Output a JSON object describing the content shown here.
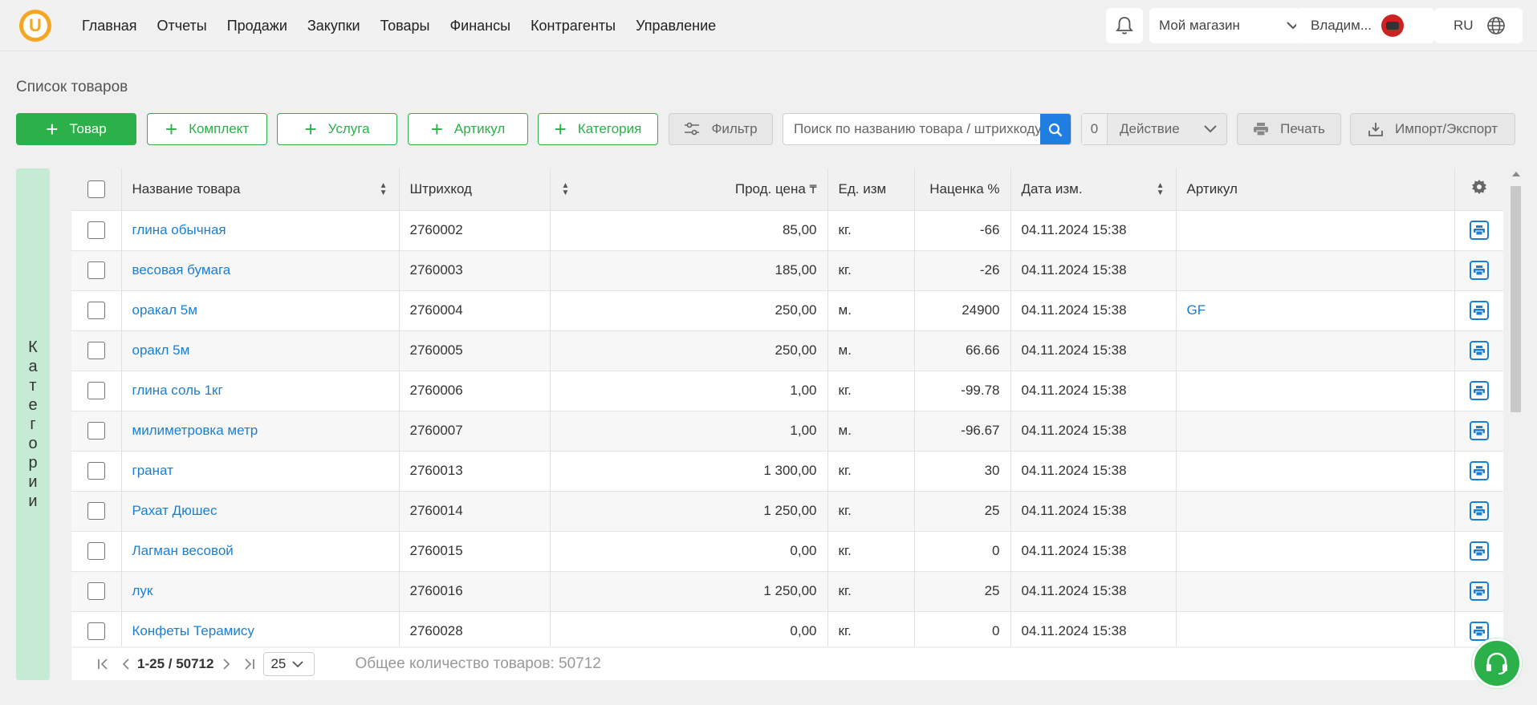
{
  "colors": {
    "brand": "#f5a623",
    "primary": "#2bb04a",
    "link": "#1a7fd4",
    "category_bar": "#c6ebd4"
  },
  "nav": [
    "Главная",
    "Отчеты",
    "Продажи",
    "Закупки",
    "Товары",
    "Финансы",
    "Контрагенты",
    "Управление"
  ],
  "header": {
    "shop": "Мой магазин",
    "user": "Владим...",
    "lang": "RU"
  },
  "page_title": "Список товаров",
  "toolbar": {
    "add_product": "Товар",
    "add_kit": "Комплект",
    "add_service": "Услуга",
    "add_article": "Артикул",
    "add_category": "Категория",
    "filter": "Фильтр",
    "search_placeholder": "Поиск по названию товара / штрихкоду",
    "selected_count": "0",
    "action": "Действие",
    "print": "Печать",
    "import_export": "Импорт/Экспорт"
  },
  "category_label": [
    "К",
    "а",
    "т",
    "е",
    "г",
    "о",
    "р",
    "и",
    "и"
  ],
  "table": {
    "columns": [
      "Название товара",
      "Штрихкод",
      "Прод. цена",
      "Ед. изм",
      "Наценка %",
      "Дата изм.",
      "Артикул"
    ],
    "rows": [
      {
        "name": "глина обычная",
        "barcode": "2760002",
        "price": "85,00",
        "unit": "кг.",
        "markup": "-66",
        "date": "04.11.2024 15:38",
        "article": ""
      },
      {
        "name": "весовая бумага",
        "barcode": "2760003",
        "price": "185,00",
        "unit": "кг.",
        "markup": "-26",
        "date": "04.11.2024 15:38",
        "article": ""
      },
      {
        "name": "оракал 5м",
        "barcode": "2760004",
        "price": "250,00",
        "unit": "м.",
        "markup": "24900",
        "date": "04.11.2024 15:38",
        "article": "GF"
      },
      {
        "name": "оракл 5м",
        "barcode": "2760005",
        "price": "250,00",
        "unit": "м.",
        "markup": "66.66",
        "date": "04.11.2024 15:38",
        "article": ""
      },
      {
        "name": "глина соль 1кг",
        "barcode": "2760006",
        "price": "1,00",
        "unit": "кг.",
        "markup": "-99.78",
        "date": "04.11.2024 15:38",
        "article": ""
      },
      {
        "name": "милиметровка метр",
        "barcode": "2760007",
        "price": "1,00",
        "unit": "м.",
        "markup": "-96.67",
        "date": "04.11.2024 15:38",
        "article": ""
      },
      {
        "name": "гранат",
        "barcode": "2760013",
        "price": "1 300,00",
        "unit": "кг.",
        "markup": "30",
        "date": "04.11.2024 15:38",
        "article": ""
      },
      {
        "name": "Рахат Дюшес",
        "barcode": "2760014",
        "price": "1 250,00",
        "unit": "кг.",
        "markup": "25",
        "date": "04.11.2024 15:38",
        "article": ""
      },
      {
        "name": "Лагман весовой",
        "barcode": "2760015",
        "price": "0,00",
        "unit": "кг.",
        "markup": "0",
        "date": "04.11.2024 15:38",
        "article": ""
      },
      {
        "name": "лук",
        "barcode": "2760016",
        "price": "1 250,00",
        "unit": "кг.",
        "markup": "25",
        "date": "04.11.2024 15:38",
        "article": ""
      },
      {
        "name": "Конфеты Терамису",
        "barcode": "2760028",
        "price": "0,00",
        "unit": "кг.",
        "markup": "0",
        "date": "04.11.2024 15:38",
        "article": ""
      }
    ]
  },
  "pagination": {
    "range": "1-25 / 50712",
    "page_size": "25",
    "total_label": "Общее количество товаров: 50712"
  }
}
